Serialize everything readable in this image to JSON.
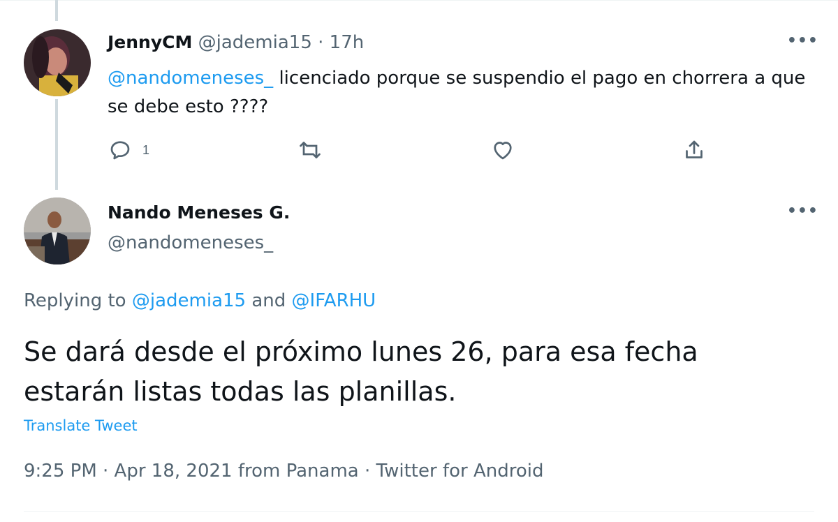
{
  "reply_tweet": {
    "display_name": "JennyCM",
    "handle": "@jademia15",
    "separator": "·",
    "time_ago": "17h",
    "mention": "@nandomeneses_",
    "text_after_mention": " licenciado porque se suspendio el pago en chorrera a que se debe esto ????",
    "reply_count": "1",
    "more_label": "•••",
    "icons": [
      "reply-icon",
      "retweet-icon",
      "like-icon",
      "share-icon"
    ]
  },
  "main_tweet": {
    "display_name": "Nando Meneses G.",
    "handle": "@nandomeneses_",
    "more_label": "•••",
    "replying_prefix": "Replying to ",
    "replying_to_1": "@jademia15",
    "replying_and": " and ",
    "replying_to_2": "@IFARHU",
    "text": "Se dará desde el próximo lunes 26, para esa fecha estarán listas todas las planillas.",
    "translate_label": "Translate Tweet",
    "meta": "9:25 PM · Apr 18, 2021 from Panama · Twitter for Android"
  },
  "colors": {
    "accent": "#1d9bf0",
    "muted": "#536471",
    "text": "#0f1419",
    "thread_line": "#cfd9de"
  }
}
